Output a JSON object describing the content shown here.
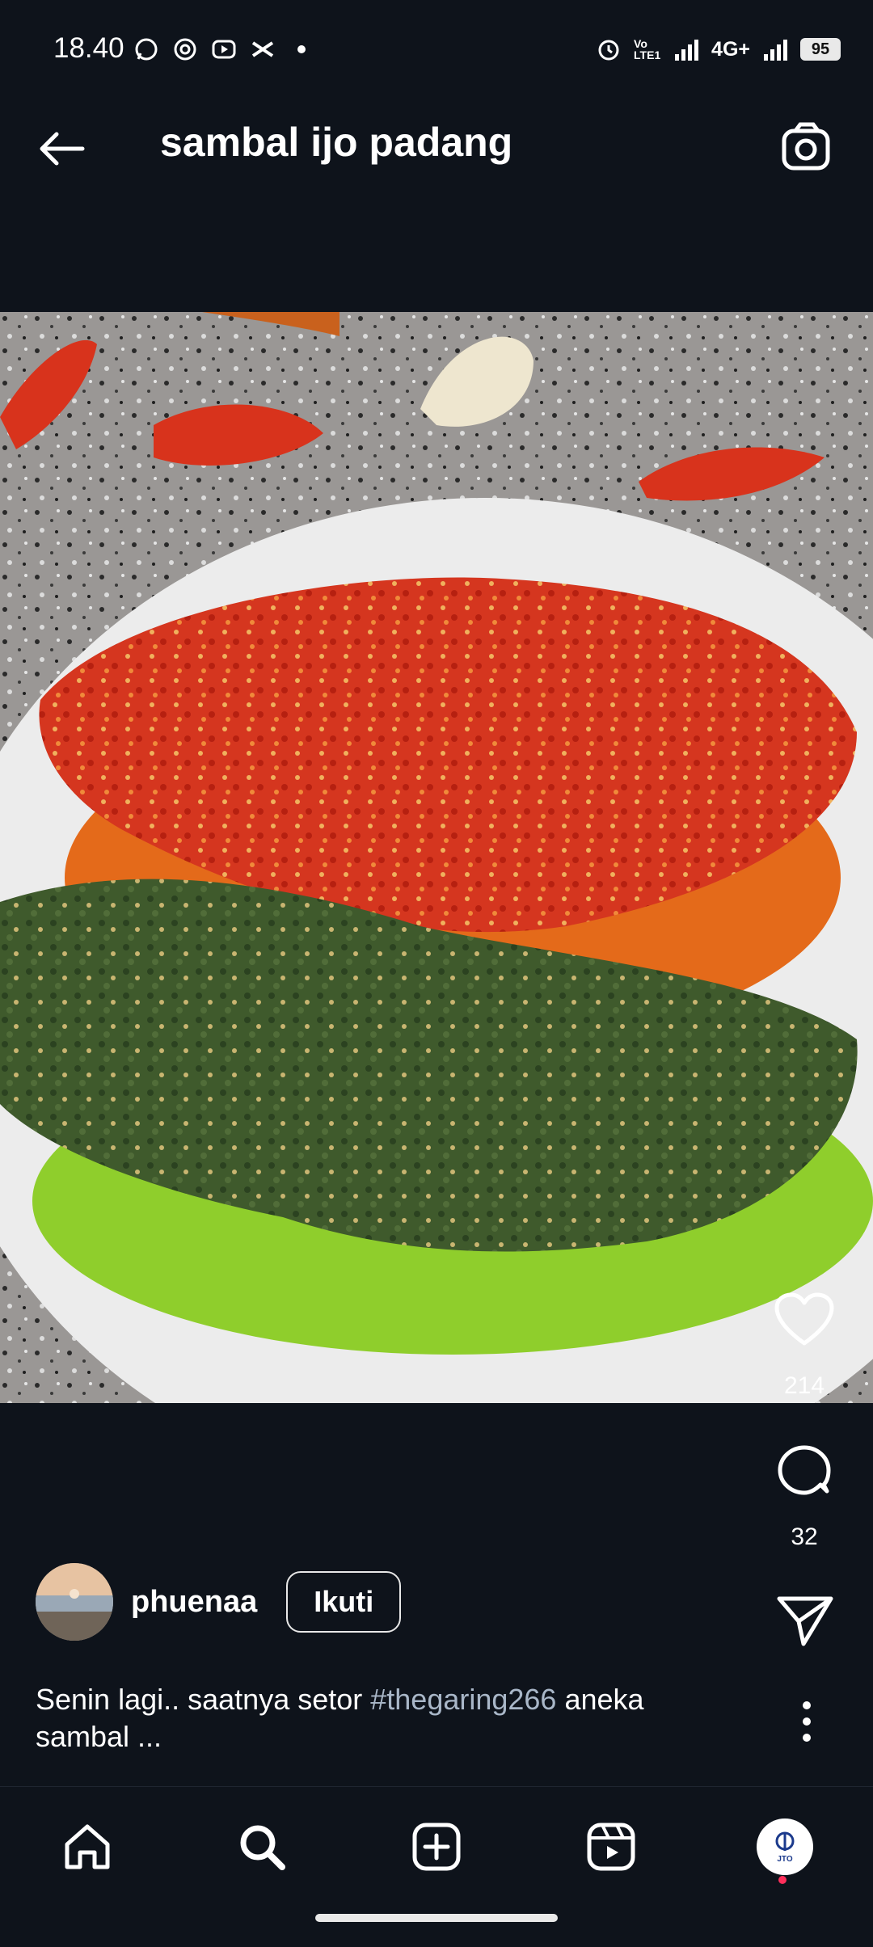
{
  "status_bar": {
    "time": "18.40",
    "left_icons": [
      "whatsapp-icon",
      "instagram-icon",
      "youtube-icon",
      "capcut-icon",
      "dot-icon"
    ],
    "right_icons": [
      "alarm-icon",
      "volte-icon",
      "signal-icon",
      "network-4g-icon",
      "signal-icon-2"
    ],
    "network_label": "4G+",
    "volte_label": "Vo LTE1",
    "battery_level": "95"
  },
  "header": {
    "title": "sambal ijo padang",
    "back_icon": "arrow-left-icon",
    "camera_icon": "camera-icon"
  },
  "post": {
    "image_alt": "Photo of red and green sambal on a white plate",
    "likes": "214",
    "comments": "32",
    "author": "phuenaa",
    "follow_label": "Ikuti",
    "caption_before": "Senin lagi.. saatnya setor ",
    "caption_hashtag": "#thegaring266",
    "caption_after": " aneka sambal ..."
  },
  "nav": {
    "items": [
      "home-icon",
      "search-icon",
      "create-post-icon",
      "reels-icon",
      "profile-avatar"
    ],
    "profile_label": "JTO"
  },
  "colors": {
    "background": "#0e131b",
    "hashtag": "#a9b7c8",
    "notification_dot": "#ff2f5b"
  }
}
